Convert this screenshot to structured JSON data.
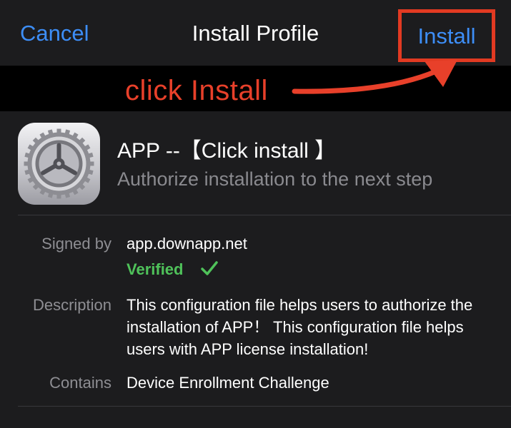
{
  "nav": {
    "cancel_label": "Cancel",
    "title": "Install Profile",
    "install_label": "Install"
  },
  "annotation": {
    "text": "click Install",
    "color": "#e8402a"
  },
  "profile": {
    "name": "APP --【Click install 】",
    "subtitle": "Authorize installation to the next step",
    "icon": "settings-gear-icon"
  },
  "details": {
    "signed_by_label": "Signed by",
    "signed_by_value": "app.downapp.net",
    "verified_label": "Verified",
    "description_label": "Description",
    "description_value": "This configuration file helps users to authorize the installation of APP！ This configuration file helps users with APP license installation!",
    "contains_label": "Contains",
    "contains_value": "Device Enrollment Challenge"
  },
  "colors": {
    "accent_blue": "#3d8ef7",
    "verified_green": "#4fc25a",
    "highlight_red": "#e23a22"
  }
}
